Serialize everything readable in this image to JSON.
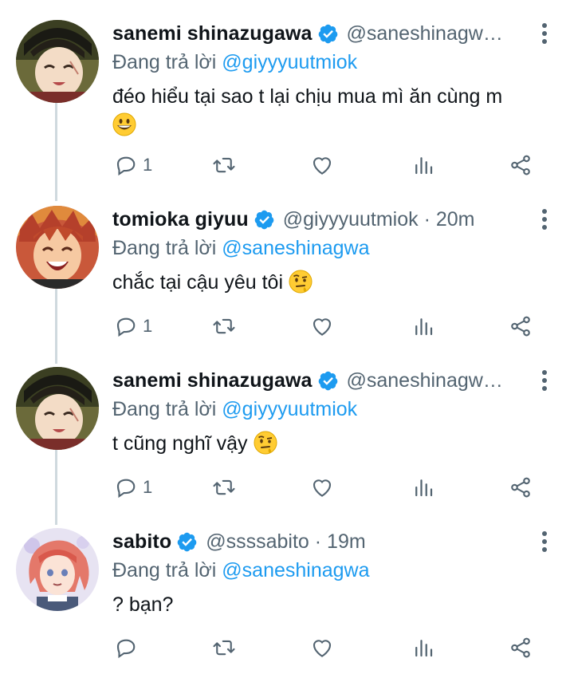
{
  "colors": {
    "link": "#1d9bf0",
    "secondary": "#536471",
    "text": "#0f1419",
    "thread_line": "#cfd9de",
    "verified": "#1d9bf0"
  },
  "replying_prefix": "Đang trả lời",
  "tweets": [
    {
      "name": "sanemi shinazugawa",
      "handle": "@saneshinagw…",
      "time": "",
      "reply_to": "@giyyyuutmiok",
      "text_lines": [
        "đéo hiểu tại sao t lại chịu mua mì ăn cùng m"
      ],
      "emoji": "grinning-face-emoji",
      "replies": "1"
    },
    {
      "name": "tomioka giyuu",
      "handle": "@giyyyuutmiok",
      "time": "· 20m",
      "reply_to": "@saneshinagwa",
      "text_lines": [
        "chắc tại cậu yêu tôi"
      ],
      "emoji": "face-with-raised-eyebrow-emoji",
      "replies": "1"
    },
    {
      "name": "sanemi shinazugawa",
      "handle": "@saneshinagw…",
      "time": "",
      "reply_to": "@giyyyuutmiok",
      "text_lines": [
        "t cũng nghĩ vậy"
      ],
      "emoji": "face-with-raised-eyebrow-emoji",
      "replies": "1"
    },
    {
      "name": "sabito",
      "handle": "@ssssabito",
      "time": "· 19m",
      "reply_to": "@saneshinagwa",
      "text_lines": [
        "? bạn?"
      ],
      "emoji": "",
      "replies": ""
    }
  ],
  "icons": {
    "verified": "verified-badge-icon",
    "more": "more-options-icon",
    "reply": "reply-icon",
    "retweet": "retweet-icon",
    "like": "heart-icon",
    "views": "views-chart-icon",
    "share": "share-icon"
  }
}
